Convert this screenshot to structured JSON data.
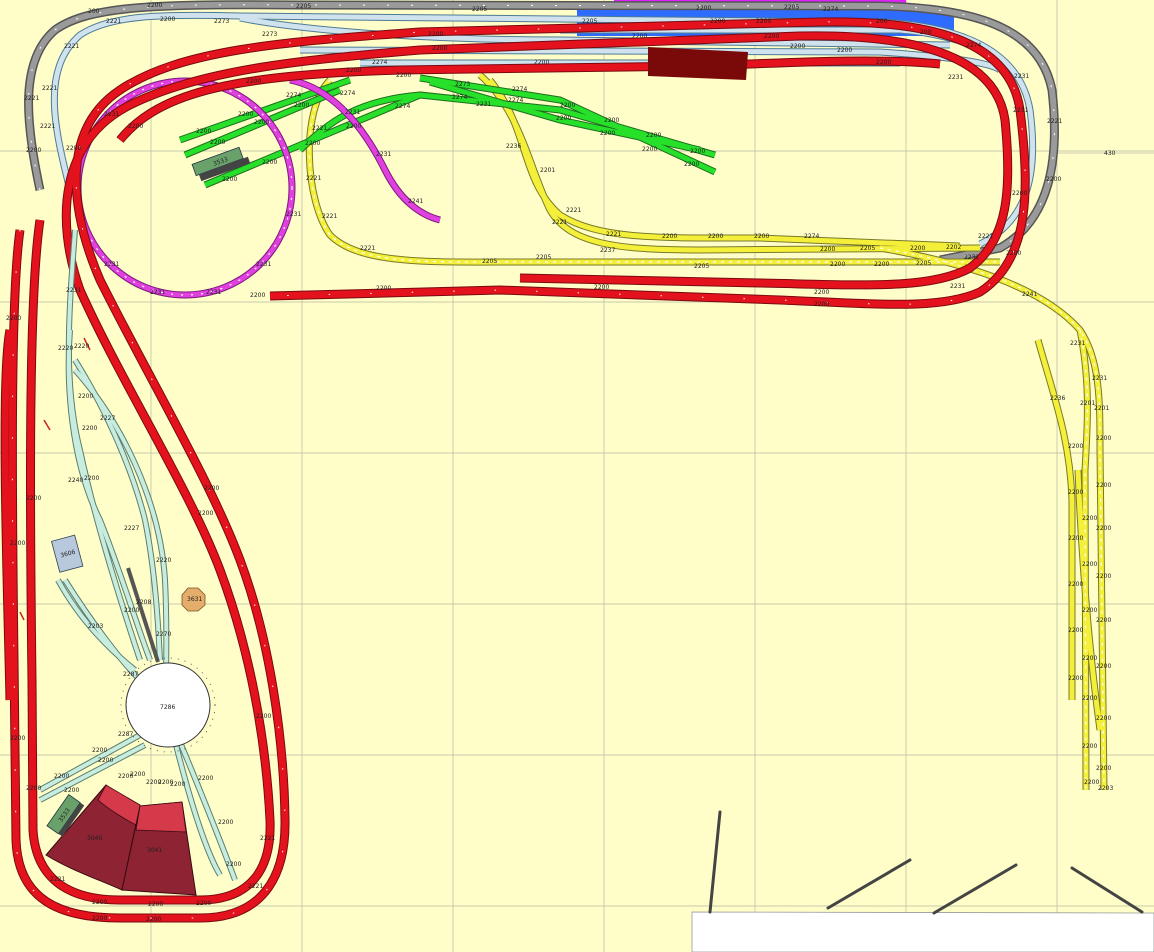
{
  "colors": {
    "background": "#fffec9",
    "grid": "#b9b9a3",
    "mainline": "#e3121d",
    "mainline_dark": "#7a0a10",
    "yard_light": "#c8ecdd",
    "yard_dark": "#5a7f72",
    "upper_blue": "#cfe2ee",
    "upper_blue_dark": "#4d7b95",
    "grey_track": "#9a9a9a",
    "green_track": "#27e02a",
    "magenta_track": "#e040e0",
    "yellow_track": "#f4f03a",
    "yellow_dark": "#7a7a2a",
    "roundhouse": "#8d2333",
    "building_dark": "#7a0a0a",
    "blue_panel": "#2e6cff",
    "magenta_panel": "#e020ff",
    "shed_green": "#6aa06a",
    "tower_orange": "#e4ad6b"
  },
  "scale_label": "430",
  "turntable_label": "7286",
  "building_labels": {
    "water_tower": "3606",
    "sand_tower": "3631",
    "roundhouse_left": "3040",
    "roundhouse_right": "3041",
    "shed_upper": "3533",
    "shed_lower": "3533"
  },
  "track_labels": [
    {
      "text": "2200"
    },
    {
      "text": "2205"
    },
    {
      "text": "2221"
    },
    {
      "text": "2231"
    },
    {
      "text": "2274"
    },
    {
      "text": "2241"
    },
    {
      "text": "2273"
    },
    {
      "text": "2237"
    },
    {
      "text": "2236"
    },
    {
      "text": "2201"
    },
    {
      "text": "2286"
    },
    {
      "text": "2229"
    },
    {
      "text": "2287"
    },
    {
      "text": "2222"
    },
    {
      "text": "2220"
    },
    {
      "text": "2240"
    },
    {
      "text": "2208"
    },
    {
      "text": "2202"
    },
    {
      "text": "2223"
    },
    {
      "text": "2270"
    },
    {
      "text": "2227"
    },
    {
      "text": "2206"
    },
    {
      "text": "2203"
    },
    {
      "text": "2224"
    },
    {
      "text": "2232"
    },
    {
      "text": "200"
    }
  ]
}
